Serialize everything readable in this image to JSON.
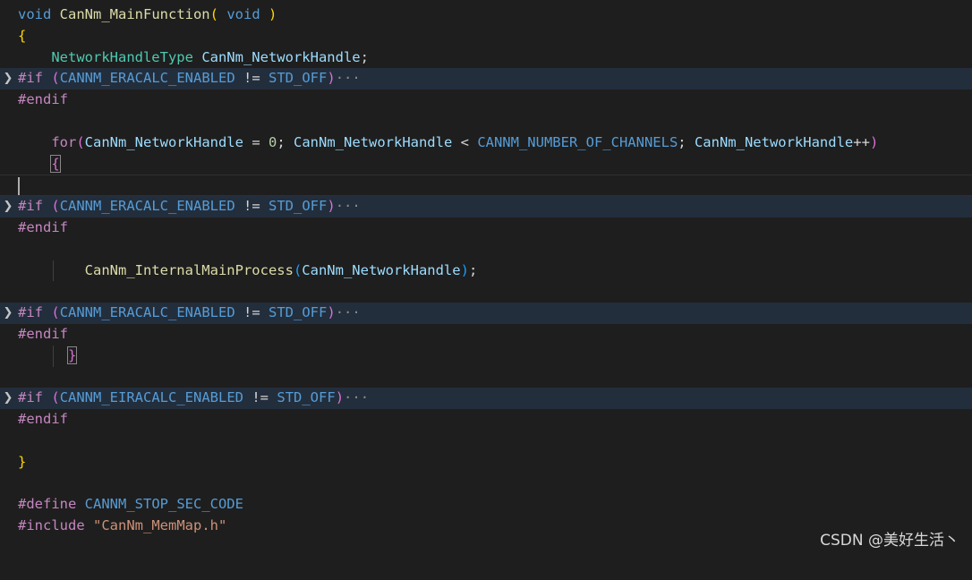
{
  "editor": {
    "lines": {
      "l1": {
        "void": "void",
        "fn": "CanNm_MainFunction",
        "open": "(",
        "arg": " void ",
        "close": ")"
      },
      "l2": {
        "brace": "{"
      },
      "l3": {
        "type": "NetworkHandleType",
        "var": "CanNm_NetworkHandle",
        "semi": ";"
      },
      "l4": {
        "pp": "#if",
        "open": "(",
        "macro": "CANNM_ERACALC_ENABLED",
        "op": "!=",
        "value": "STD_OFF",
        "close": ")",
        "ellipsis": "···"
      },
      "l5": {
        "pp": "#endif"
      },
      "l7": {
        "kw": "for",
        "open": "(",
        "var1": "CanNm_NetworkHandle",
        "eq": " = ",
        "num": "0",
        "semi1": "; ",
        "var2": "CanNm_NetworkHandle",
        "lt": " < ",
        "macro": "CANNM_NUMBER_OF_CHANNELS",
        "semi2": "; ",
        "var3": "CanNm_NetworkHandle",
        "inc": "++",
        "close": ")"
      },
      "l8": {
        "brace": "{"
      },
      "l10": {
        "pp": "#if",
        "open": "(",
        "macro": "CANNM_ERACALC_ENABLED",
        "op": "!=",
        "value": "STD_OFF",
        "close": ")",
        "ellipsis": "···"
      },
      "l11": {
        "pp": "#endif"
      },
      "l13": {
        "fn": "CanNm_InternalMainProcess",
        "open": "(",
        "var": "CanNm_NetworkHandle",
        "close": ")",
        "semi": ";"
      },
      "l15": {
        "pp": "#if",
        "open": "(",
        "macro": "CANNM_ERACALC_ENABLED",
        "op": "!=",
        "value": "STD_OFF",
        "close": ")",
        "ellipsis": "···"
      },
      "l16": {
        "pp": "#endif"
      },
      "l17": {
        "brace": "}"
      },
      "l19": {
        "pp": "#if",
        "open": "(",
        "macro": "CANNM_EIRACALC_ENABLED",
        "op": "!=",
        "value": "STD_OFF",
        "close": ")",
        "ellipsis": "···"
      },
      "l20": {
        "pp": "#endif"
      },
      "l22": {
        "brace": "}"
      },
      "l24": {
        "pp": "#define",
        "macro": "CANNM_STOP_SEC_CODE"
      },
      "l25": {
        "pp": "#include",
        "str": "\"CanNm_MemMap.h\""
      }
    },
    "fold_icon": "chevron-right-icon"
  },
  "watermark": "CSDN @美好生活丶"
}
